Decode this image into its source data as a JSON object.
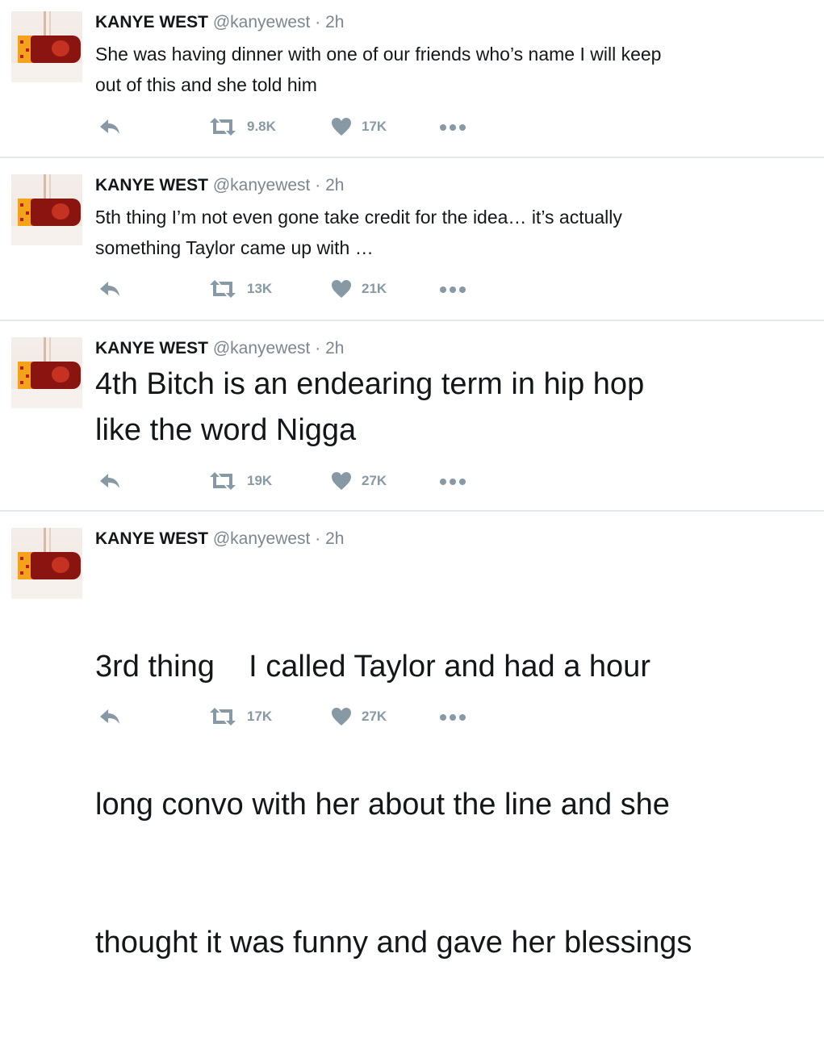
{
  "tweets": [
    {
      "name": "KANYE WEST",
      "handle": "@kanyewest",
      "separator": "·",
      "time": "2h",
      "text_lines": [
        "She was having dinner with one of our friends who’s name I will keep",
        "out of this and she told him"
      ],
      "retweets": "9.8K",
      "likes": "17K"
    },
    {
      "name": "KANYE WEST",
      "handle": "@kanyewest",
      "separator": "·",
      "time": "2h",
      "text_lines": [
        "5th  thing I’m not even gone take credit for the idea… it’s actually",
        "something Taylor came up with …"
      ],
      "retweets": "13K",
      "likes": "21K"
    },
    {
      "name": "KANYE WEST",
      "handle": "@kanyewest",
      "separator": "·",
      "time": "2h",
      "text_lines": [
        "4th Bitch is an endearing term in hip hop",
        "like the word Nigga"
      ],
      "retweets": "19K",
      "likes": "27K"
    },
    {
      "name": "KANYE WEST",
      "handle": "@kanyewest",
      "separator": "·",
      "time": "2h",
      "text_lines": [
        "3rd thing    I called Taylor and had a hour",
        "long convo with her about the line and she",
        "thought it was funny and gave her blessings"
      ],
      "retweets": "17K",
      "likes": "27K"
    }
  ],
  "icons": {
    "reply": "reply-icon",
    "retweet": "retweet-icon",
    "like": "heart-icon",
    "more": "more-icon"
  },
  "colors": {
    "icon_gray": "#8899a6",
    "divider": "#e1e8ed"
  }
}
